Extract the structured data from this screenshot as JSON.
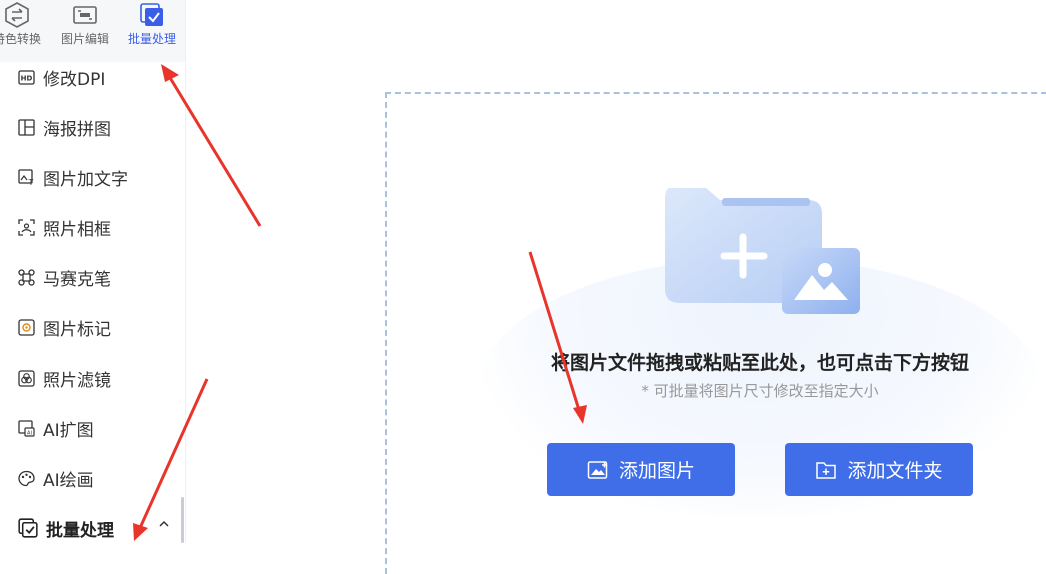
{
  "top_tabs": [
    {
      "label": "特色转换",
      "icon": "swap-icon"
    },
    {
      "label": "图片编辑",
      "icon": "image-edit-icon"
    },
    {
      "label": "批量处理",
      "icon": "batch-check-icon",
      "active": true
    }
  ],
  "sidebar": {
    "items": [
      {
        "label": "修改DPI",
        "icon": "hd-icon"
      },
      {
        "label": "海报拼图",
        "icon": "layout-icon"
      },
      {
        "label": "图片加文字",
        "icon": "image-text-icon"
      },
      {
        "label": "照片相框",
        "icon": "photo-frame-icon"
      },
      {
        "label": "马赛克笔",
        "icon": "mosaic-icon"
      },
      {
        "label": "图片标记",
        "icon": "mark-icon"
      },
      {
        "label": "照片滤镜",
        "icon": "filter-icon"
      },
      {
        "label": "AI扩图",
        "icon": "ai-expand-icon"
      },
      {
        "label": "AI绘画",
        "icon": "palette-icon"
      }
    ],
    "section": {
      "label": "批量处理",
      "icon": "batch-check-icon",
      "expanded": true
    }
  },
  "main": {
    "drop_hint": "将图片文件拖拽或粘贴至此处，也可点击下方按钮",
    "sub_hint": "* 可批量将图片尺寸修改至指定大小",
    "add_image_label": "添加图片",
    "add_folder_label": "添加文件夹"
  },
  "colors": {
    "accent": "#3f6ee8",
    "annotation_arrow": "#e8342a"
  }
}
